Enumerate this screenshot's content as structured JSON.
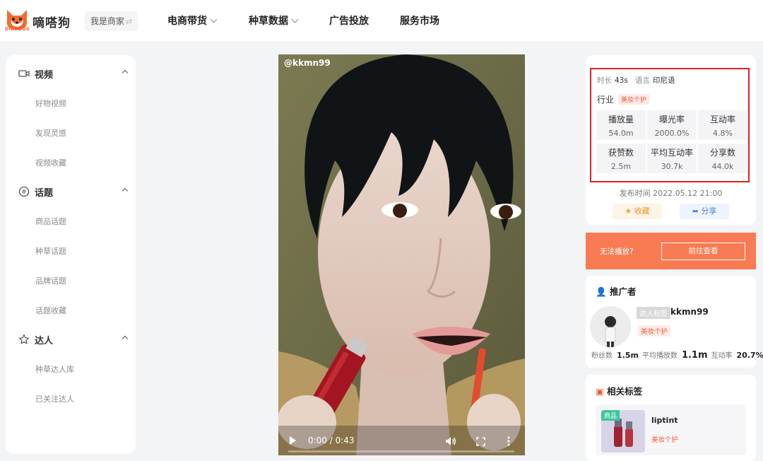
{
  "header": {
    "logo_text": "嘀嗒狗",
    "logo_sub": "DIDADOG",
    "merchant_label": "我是商家",
    "swap_glyph": "⇄",
    "nav": [
      {
        "label": "电商带货",
        "has_dropdown": true
      },
      {
        "label": "种草数据",
        "has_dropdown": true
      },
      {
        "label": "广告投放",
        "has_dropdown": false
      },
      {
        "label": "服务市场",
        "has_dropdown": false
      }
    ]
  },
  "sidebar": {
    "sections": [
      {
        "title": "视频",
        "icon": "video-icon",
        "items": [
          "好物视频",
          "发现灵感",
          "视频收藏"
        ]
      },
      {
        "title": "话题",
        "icon": "hashtag-icon",
        "items": [
          "商品话题",
          "种草话题",
          "品牌话题",
          "话题收藏"
        ]
      },
      {
        "title": "达人",
        "icon": "star-icon",
        "items": [
          "种草达人库",
          "已关注达人"
        ]
      }
    ]
  },
  "video": {
    "handle": "@kkmn99",
    "time": "0:00 / 0:43",
    "progress": 0.0
  },
  "info": {
    "duration_label": "时长",
    "duration": "43s",
    "language_label": "语言",
    "language": "印尼语",
    "industry_label": "行业",
    "industry": "美妆个护",
    "stats": [
      {
        "label": "播放量",
        "value": "54.0m"
      },
      {
        "label": "曝光率",
        "value": "2000.0%"
      },
      {
        "label": "互动率",
        "value": "4.8%"
      },
      {
        "label": "获赞数",
        "value": "2.5m"
      },
      {
        "label": "平均互动率",
        "value": "30.7k"
      },
      {
        "label": "分享数",
        "value": "44.0k"
      }
    ],
    "publish": "发布时间 2022.05.12 21:00",
    "fav_label": "收藏",
    "share_label": "分享"
  },
  "cannot_play": {
    "text": "无法播放?",
    "button": "前往查看"
  },
  "promoter": {
    "title": "推广者",
    "badge": "达人标签",
    "name": "kkmn99",
    "category": "美妆个护",
    "fans_label": "粉丝数",
    "fans": "1.5m",
    "avg_play_label": "平均播放数",
    "avg_play": "1.1m",
    "interaction_label": "互动率",
    "interaction": "20.7%"
  },
  "related": {
    "title": "相关标签",
    "product_tag": "商品",
    "product_name": "liptint",
    "product_category": "美妆个护"
  },
  "colors": {
    "accent_orange": "#f97b53",
    "highlight_red": "#e02020",
    "tag_red": "#f25c3e"
  }
}
